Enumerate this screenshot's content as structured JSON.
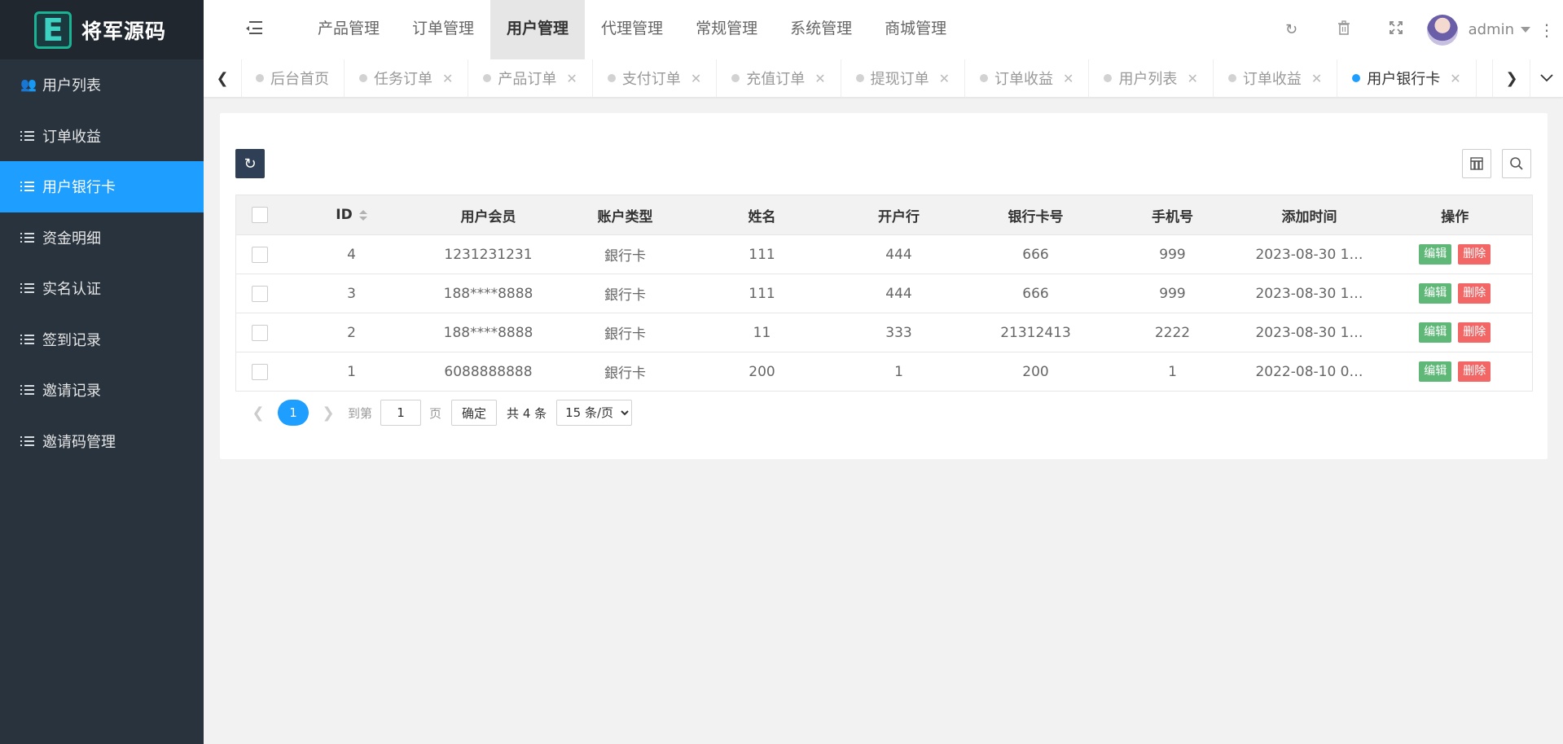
{
  "brand": {
    "logo_letter": "E",
    "name": "将军源码"
  },
  "sidebar": {
    "items": [
      {
        "label": "用户列表",
        "icon": "users-icon",
        "active": false
      },
      {
        "label": "订单收益",
        "icon": "list-icon",
        "active": false
      },
      {
        "label": "用户银行卡",
        "icon": "list-icon",
        "active": true
      },
      {
        "label": "资金明细",
        "icon": "list-icon",
        "active": false
      },
      {
        "label": "实名认证",
        "icon": "list-icon",
        "active": false
      },
      {
        "label": "签到记录",
        "icon": "list-icon",
        "active": false
      },
      {
        "label": "邀请记录",
        "icon": "list-icon",
        "active": false
      },
      {
        "label": "邀请码管理",
        "icon": "list-icon",
        "active": false
      }
    ]
  },
  "header": {
    "nav": [
      "产品管理",
      "订单管理",
      "用户管理",
      "代理管理",
      "常规管理",
      "系统管理",
      "商城管理"
    ],
    "active_nav": "用户管理",
    "username": "admin"
  },
  "tabs": [
    {
      "label": "后台首页",
      "closable": false,
      "active": false
    },
    {
      "label": "任务订单",
      "closable": true,
      "active": false
    },
    {
      "label": "产品订单",
      "closable": true,
      "active": false
    },
    {
      "label": "支付订单",
      "closable": true,
      "active": false
    },
    {
      "label": "充值订单",
      "closable": true,
      "active": false
    },
    {
      "label": "提现订单",
      "closable": true,
      "active": false
    },
    {
      "label": "订单收益",
      "closable": true,
      "active": false
    },
    {
      "label": "用户列表",
      "closable": true,
      "active": false
    },
    {
      "label": "订单收益",
      "closable": true,
      "active": false
    },
    {
      "label": "用户银行卡",
      "closable": true,
      "active": true
    }
  ],
  "table": {
    "columns": [
      "ID",
      "用户会员",
      "账户类型",
      "姓名",
      "开户行",
      "银行卡号",
      "手机号",
      "添加时间",
      "操作"
    ],
    "rows": [
      {
        "id": "4",
        "member": "1231231231",
        "type": "銀行卡",
        "name": "111",
        "bank": "444",
        "card": "666",
        "phone": "999",
        "time": "2023-08-30 1…"
      },
      {
        "id": "3",
        "member": "188****8888",
        "type": "銀行卡",
        "name": "111",
        "bank": "444",
        "card": "666",
        "phone": "999",
        "time": "2023-08-30 1…"
      },
      {
        "id": "2",
        "member": "188****8888",
        "type": "銀行卡",
        "name": "11",
        "bank": "333",
        "card": "21312413",
        "phone": "2222",
        "time": "2023-08-30 1…"
      },
      {
        "id": "1",
        "member": "6088888888",
        "type": "銀行卡",
        "name": "200",
        "bank": "1",
        "card": "200",
        "phone": "1",
        "time": "2022-08-10 0…"
      }
    ],
    "edit_label": "编辑",
    "delete_label": "删除"
  },
  "pagination": {
    "current_page": "1",
    "goto_prefix": "到第",
    "goto_value": "1",
    "goto_suffix": "页",
    "confirm_label": "确定",
    "total_text": "共 4 条",
    "page_size": "15 条/页"
  },
  "colors": {
    "active_blue": "#1e9fff",
    "sidebar_bg": "#28333e",
    "edit_green": "#5fb878",
    "delete_red": "#f26666"
  }
}
